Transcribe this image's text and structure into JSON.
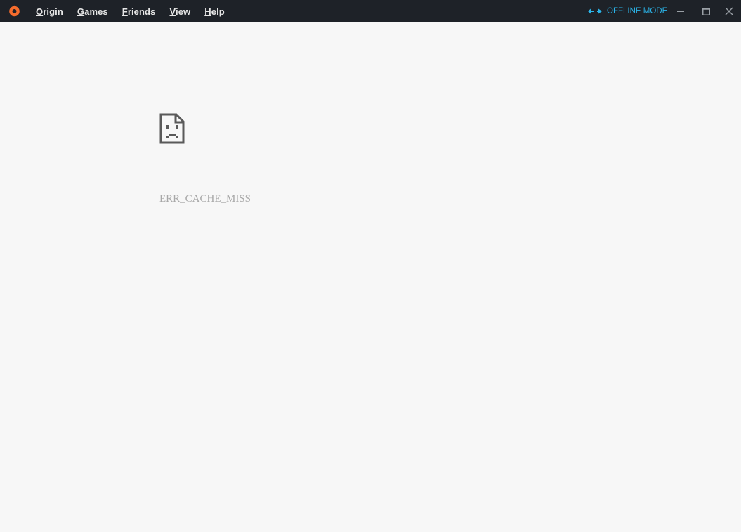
{
  "menu": {
    "items": [
      {
        "accel": "O",
        "rest": "rigin"
      },
      {
        "accel": "G",
        "rest": "ames"
      },
      {
        "accel": "F",
        "rest": "riends"
      },
      {
        "accel": "V",
        "rest": "iew"
      },
      {
        "accel": "H",
        "rest": "elp"
      }
    ]
  },
  "status": {
    "offline_label": "OFFLINE MODE",
    "color": "#2bb5ea"
  },
  "error": {
    "code": "ERR_CACHE_MISS",
    "icon": "sad-page-icon"
  },
  "colors": {
    "titlebar": "#1e2228",
    "background": "#f7f7f7",
    "brand": "#f56c2d"
  }
}
